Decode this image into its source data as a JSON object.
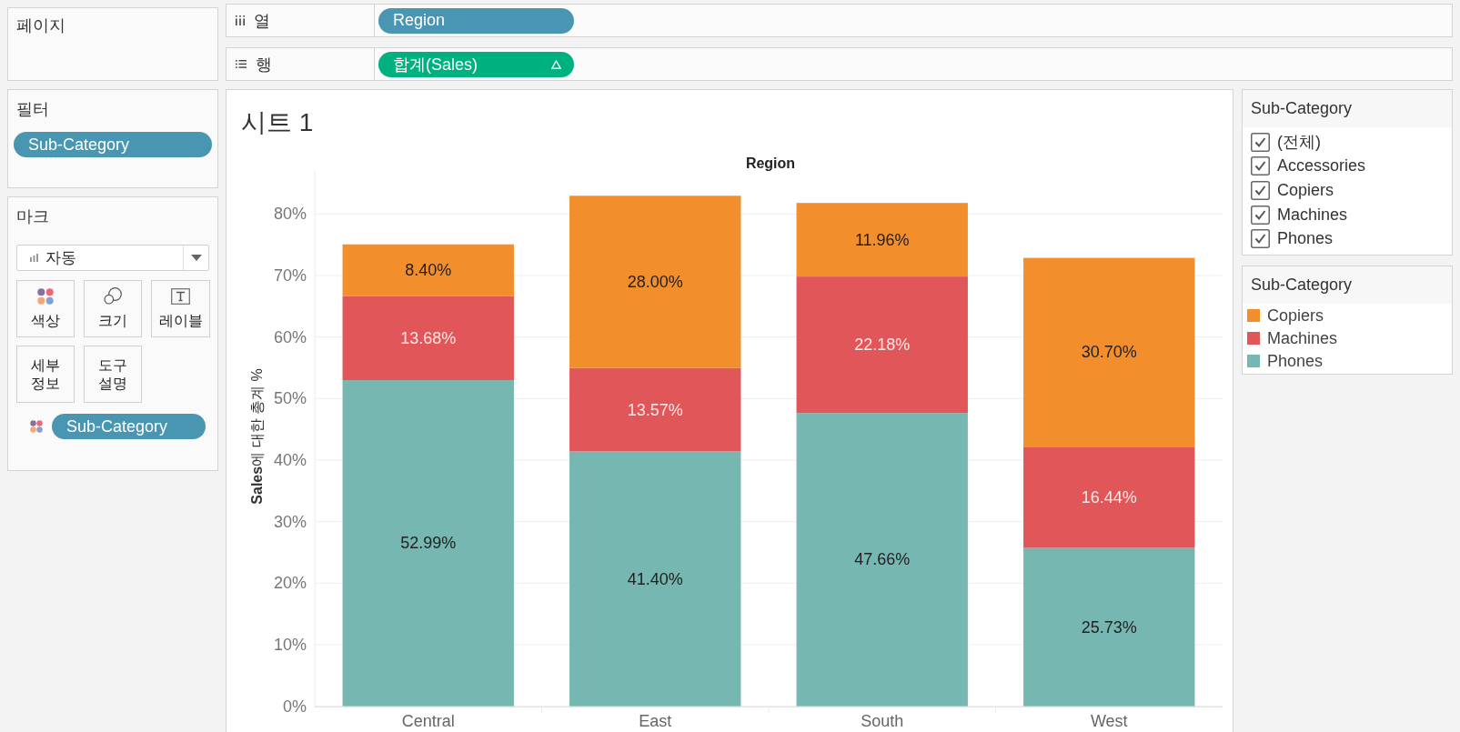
{
  "pages_card": {
    "title": "페이지"
  },
  "filters_card": {
    "title": "필터",
    "pills": [
      {
        "label": "Sub-Category",
        "kind": "dimension"
      }
    ]
  },
  "marks_card": {
    "title": "마크",
    "mark_type": "자동",
    "buttons": [
      {
        "label": "색상",
        "kind": "color"
      },
      {
        "label": "크기",
        "kind": "size"
      },
      {
        "label": "레이블",
        "kind": "label"
      },
      {
        "label": "세부 정보",
        "kind": "detail"
      },
      {
        "label": "도구 설명",
        "kind": "tooltip"
      }
    ],
    "encodings": [
      {
        "kind": "color",
        "label": "Sub-Category"
      }
    ]
  },
  "shelves": [
    {
      "kind": "columns",
      "label": "열",
      "pills": [
        {
          "label": "Region",
          "kind": "dimension"
        }
      ]
    },
    {
      "kind": "rows",
      "label": "행",
      "pills": [
        {
          "label": "합계(Sales)",
          "kind": "measure",
          "table_calc": true
        }
      ]
    }
  ],
  "sheet": {
    "title": "시트 1",
    "chart_data": {
      "type": "bar",
      "stacked": true,
      "grid": true,
      "title": "Region",
      "ylabel": "**Sales**에 대한 총계 %",
      "categories": [
        "Central",
        "East",
        "South",
        "West"
      ],
      "series": [
        {
          "name": "Copiers",
          "color": "#f28e2b",
          "values": [
            8.4,
            28.0,
            11.96,
            30.7
          ]
        },
        {
          "name": "Machines",
          "color": "#e15759",
          "values": [
            13.68,
            13.57,
            22.18,
            16.44
          ]
        },
        {
          "name": "Phones",
          "color": "#76b7b2",
          "values": [
            52.99,
            41.4,
            47.66,
            25.73
          ]
        }
      ],
      "ylim": [
        0,
        87
      ],
      "yticks": [
        {
          "value": 0,
          "label": "0%"
        },
        {
          "value": 10,
          "label": "10%"
        },
        {
          "value": 20,
          "label": "20%"
        },
        {
          "value": 30,
          "label": "30%"
        },
        {
          "value": 40,
          "label": "40%"
        },
        {
          "value": 50,
          "label": "50%"
        },
        {
          "value": 60,
          "label": "60%"
        },
        {
          "value": 70,
          "label": "70%"
        },
        {
          "value": 80,
          "label": "80%"
        }
      ],
      "value_labels": [
        [
          "8.40%",
          "28.00%",
          "11.96%",
          "30.70%"
        ],
        [
          "13.68%",
          "13.57%",
          "22.18%",
          "16.44%"
        ],
        [
          "52.99%",
          "41.40%",
          "47.66%",
          "25.73%"
        ]
      ]
    }
  },
  "filter_legend": {
    "title": "Sub-Category",
    "items": [
      {
        "label": "(전체)",
        "checked": true
      },
      {
        "label": "Accessories",
        "checked": true
      },
      {
        "label": "Copiers",
        "checked": true
      },
      {
        "label": "Machines",
        "checked": true
      },
      {
        "label": "Phones",
        "checked": true
      }
    ]
  },
  "color_legend": {
    "title": "Sub-Category"
  }
}
